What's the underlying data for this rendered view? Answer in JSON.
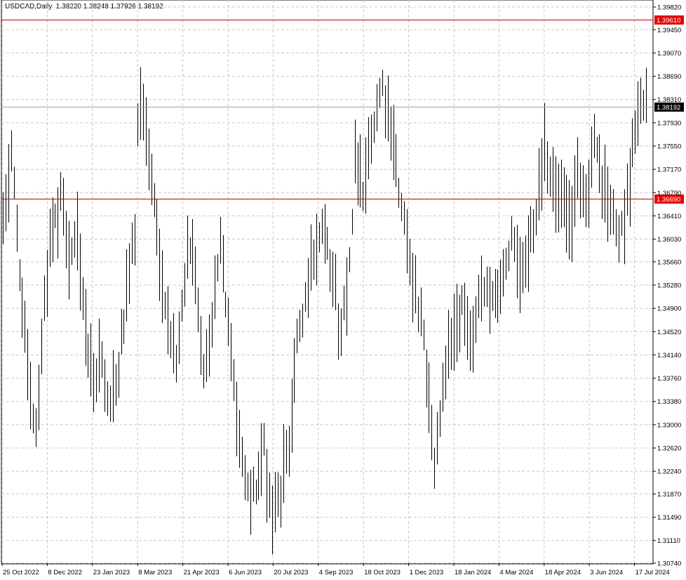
{
  "header": {
    "symbol": "USDCAD,Daily",
    "ohlc": "1.38220 1.38248 1.37926 1.38192"
  },
  "colors": {
    "background": "#ffffff",
    "grid": "#c8c8c8",
    "bars": "#000000",
    "level_line": "#c00000",
    "level_tag_bg": "#e60000",
    "price_tag_bg": "#000000",
    "tag_text": "#ffffff"
  },
  "chart_data": {
    "type": "bar",
    "title": "USDCAD,Daily",
    "x_tick_labels": [
      "25 Oct 2022",
      "8 Dec 2022",
      "23 Jan 2023",
      "8 Mar 2023",
      "21 Apr 2023",
      "6 Jun 2023",
      "20 Jul 2023",
      "4 Sep 2023",
      "18 Oct 2023",
      "1 Dec 2023",
      "18 Jan 2024",
      "4 Mar 2024",
      "18 Apr 2024",
      "3 Jun 2024",
      "17 Jul 2024"
    ],
    "y_tick_labels": [
      "1.39820",
      "1.39450",
      "1.39070",
      "1.38690",
      "1.38310",
      "1.37930",
      "1.37550",
      "1.37170",
      "1.36790",
      "1.36410",
      "1.36030",
      "1.35660",
      "1.35280",
      "1.34900",
      "1.34520",
      "1.34140",
      "1.33760",
      "1.33380",
      "1.33000",
      "1.32620",
      "1.32240",
      "1.31870",
      "1.31490",
      "1.31110",
      "1.30740"
    ],
    "ylim": [
      1.3074,
      1.3982
    ],
    "grid": true,
    "horizontal_levels": [
      {
        "price": 1.3961,
        "label": "1.39610",
        "style": "red-line"
      },
      {
        "price": 1.3669,
        "label": "1.36690",
        "style": "red-line"
      }
    ],
    "current_price": {
      "price": 1.38192,
      "label": "1.38192"
    },
    "anchors": [
      {
        "x": 0,
        "y": 1.362
      },
      {
        "x": 3,
        "y": 1.375
      },
      {
        "x": 6,
        "y": 1.356
      },
      {
        "x": 9,
        "y": 1.337
      },
      {
        "x": 12,
        "y": 1.329
      },
      {
        "x": 15,
        "y": 1.351
      },
      {
        "x": 18,
        "y": 1.362
      },
      {
        "x": 21,
        "y": 1.366
      },
      {
        "x": 24,
        "y": 1.358
      },
      {
        "x": 27,
        "y": 1.36
      },
      {
        "x": 30,
        "y": 1.345
      },
      {
        "x": 33,
        "y": 1.337
      },
      {
        "x": 36,
        "y": 1.341
      },
      {
        "x": 39,
        "y": 1.332
      },
      {
        "x": 42,
        "y": 1.339
      },
      {
        "x": 45,
        "y": 1.351
      },
      {
        "x": 48,
        "y": 1.362
      },
      {
        "x": 49,
        "y": 1.378
      },
      {
        "x": 50,
        "y": 1.383
      },
      {
        "x": 52,
        "y": 1.377
      },
      {
        "x": 55,
        "y": 1.366
      },
      {
        "x": 57,
        "y": 1.356
      },
      {
        "x": 60,
        "y": 1.348
      },
      {
        "x": 63,
        "y": 1.339
      },
      {
        "x": 65,
        "y": 1.348
      },
      {
        "x": 67,
        "y": 1.361
      },
      {
        "x": 69,
        "y": 1.358
      },
      {
        "x": 71,
        "y": 1.349
      },
      {
        "x": 73,
        "y": 1.34
      },
      {
        "x": 75,
        "y": 1.344
      },
      {
        "x": 77,
        "y": 1.353
      },
      {
        "x": 79,
        "y": 1.36
      },
      {
        "x": 81,
        "y": 1.35
      },
      {
        "x": 84,
        "y": 1.337
      },
      {
        "x": 87,
        "y": 1.324
      },
      {
        "x": 90,
        "y": 1.317
      },
      {
        "x": 93,
        "y": 1.322
      },
      {
        "x": 95,
        "y": 1.326
      },
      {
        "x": 98,
        "y": 1.316
      },
      {
        "x": 101,
        "y": 1.319
      },
      {
        "x": 104,
        "y": 1.327
      },
      {
        "x": 106,
        "y": 1.34
      },
      {
        "x": 108,
        "y": 1.345
      },
      {
        "x": 111,
        "y": 1.353
      },
      {
        "x": 114,
        "y": 1.359
      },
      {
        "x": 117,
        "y": 1.364
      },
      {
        "x": 120,
        "y": 1.354
      },
      {
        "x": 123,
        "y": 1.345
      },
      {
        "x": 126,
        "y": 1.358
      },
      {
        "x": 128,
        "y": 1.372
      },
      {
        "x": 131,
        "y": 1.369
      },
      {
        "x": 134,
        "y": 1.378
      },
      {
        "x": 137,
        "y": 1.386
      },
      {
        "x": 140,
        "y": 1.382
      },
      {
        "x": 143,
        "y": 1.372
      },
      {
        "x": 146,
        "y": 1.362
      },
      {
        "x": 149,
        "y": 1.353
      },
      {
        "x": 152,
        "y": 1.348
      },
      {
        "x": 155,
        "y": 1.335
      },
      {
        "x": 157,
        "y": 1.324
      },
      {
        "x": 159,
        "y": 1.33
      },
      {
        "x": 161,
        "y": 1.339
      },
      {
        "x": 164,
        "y": 1.345
      },
      {
        "x": 167,
        "y": 1.35
      },
      {
        "x": 170,
        "y": 1.343
      },
      {
        "x": 173,
        "y": 1.35
      },
      {
        "x": 176,
        "y": 1.353
      },
      {
        "x": 179,
        "y": 1.349
      },
      {
        "x": 182,
        "y": 1.355
      },
      {
        "x": 185,
        "y": 1.36
      },
      {
        "x": 188,
        "y": 1.353
      },
      {
        "x": 191,
        "y": 1.358
      },
      {
        "x": 194,
        "y": 1.366
      },
      {
        "x": 197,
        "y": 1.376
      },
      {
        "x": 200,
        "y": 1.368
      },
      {
        "x": 203,
        "y": 1.366
      },
      {
        "x": 206,
        "y": 1.363
      },
      {
        "x": 209,
        "y": 1.37
      },
      {
        "x": 212,
        "y": 1.365
      },
      {
        "x": 215,
        "y": 1.376
      },
      {
        "x": 218,
        "y": 1.37
      },
      {
        "x": 221,
        "y": 1.365
      },
      {
        "x": 224,
        "y": 1.36
      },
      {
        "x": 226,
        "y": 1.364
      },
      {
        "x": 228,
        "y": 1.371
      },
      {
        "x": 230,
        "y": 1.378
      },
      {
        "x": 232,
        "y": 1.384
      },
      {
        "x": 234,
        "y": 1.381
      },
      {
        "x": 235,
        "y": 1.382
      }
    ]
  }
}
